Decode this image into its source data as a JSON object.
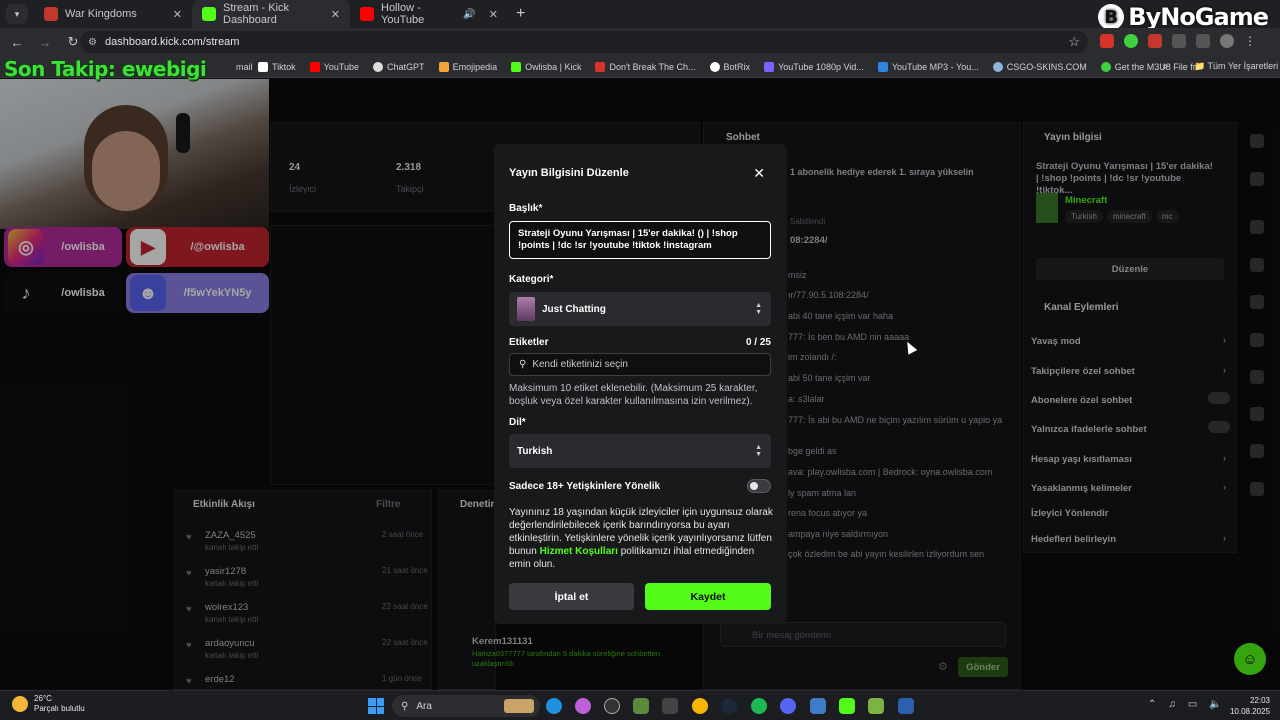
{
  "browser": {
    "tabs": [
      {
        "label": "War Kingdoms",
        "color": "#c0392b",
        "active": false
      },
      {
        "label": "Stream - Kick Dashboard",
        "color": "#53fc18",
        "active": true
      },
      {
        "label": "Hollow - YouTube",
        "color": "#ff0000",
        "active": false
      }
    ],
    "url": "dashboard.kick.com/stream",
    "brand": "ByNoGame",
    "bookmarks": [
      {
        "label": "Tiktok",
        "color": "#ffffff"
      },
      {
        "label": "YouTube",
        "color": "#ff0000"
      },
      {
        "label": "ChatGPT",
        "color": "#dddddd"
      },
      {
        "label": "Emojipedia",
        "color": "#f2a33a"
      },
      {
        "label": "Owlisba | Kick",
        "color": "#53fc18"
      },
      {
        "label": "Don't Break The Ch...",
        "color": "#d6332b"
      },
      {
        "label": "BotRix",
        "color": "#ffffff"
      },
      {
        "label": "YouTube 1080p Vid...",
        "color": "#7b61ff"
      },
      {
        "label": "YouTube MP3 - You...",
        "color": "#2e86de"
      },
      {
        "label": "CSGO-SKINS.COM",
        "color": "#8fb3d9"
      },
      {
        "label": "Get the M3U8 File fr...",
        "color": "#3fd13f"
      }
    ],
    "bookmarks_cut_label": "mail",
    "all_bookmarks": "Tüm Yer İşaretleri"
  },
  "overlay": {
    "follow_text": "Son Takip: ewebigi",
    "socials": [
      {
        "label": "/owlisba",
        "icon": "instagram-icon",
        "color": "#b52a9b"
      },
      {
        "label": "/@owlisba",
        "icon": "youtube-icon",
        "color": "#c4262e"
      },
      {
        "label": "/owlisba",
        "icon": "tiktok-icon",
        "color": "#101010"
      },
      {
        "label": "/f5wYekYN5y",
        "icon": "discord-icon",
        "color": "#8a80e6"
      }
    ]
  },
  "dashboard": {
    "stats": [
      {
        "value": "24",
        "label": "İzleyici"
      },
      {
        "value": "2.318",
        "label": "Takipçi"
      }
    ],
    "activity": {
      "title": "Etkinlik Akışı",
      "filter": "Filtre",
      "items": [
        {
          "name": "ZAZA_4525",
          "action": "kanalı takip etti",
          "time": "2 saat önce"
        },
        {
          "name": "yasir1278",
          "action": "kanalı takip etti",
          "time": "21 saat önce"
        },
        {
          "name": "wolrex123",
          "action": "kanalı takip etti",
          "time": "22 saat önce"
        },
        {
          "name": "ardaoyuncu",
          "action": "kanalı takip etti",
          "time": "22 saat önce"
        },
        {
          "name": "erde12",
          "action": "",
          "time": "1 gün önce"
        }
      ]
    },
    "moderation": {
      "title": "Denetim",
      "last_user": "Kerem131131",
      "last_detail": "Hamza0377777 tarafından 5 dakika süreliğine sohbetten uzaklaştırıldı"
    },
    "chat": {
      "title": "Sohbet",
      "gift_banner": "1 abonelik hediye ederek 1. sıraya yükselin",
      "pinned_label": "Sabitlendi",
      "pinned_text": "08:2284/",
      "lines": [
        "msiz",
        "ır/77.90.5.108:2284/",
        "abi 40 tane içşim var haha",
        "777: İs ben bu AMD nin aaaaa",
        "im zolandı /:",
        "abi 50 tane içşim var",
        "a: s3lalar",
        "777: İs abi bu AMD ne biçim yazılım sürüm u yapio ya",
        "bge geldi as",
        "ava: play.owlisba.com | Bedrock: oyna.owlisba.com",
        "ly spam atma lan",
        "rena focus atıyor ya",
        "ampaya niye saldırmıyon",
        "çok özledim be abi yayın kesilirlen izliyordum sen"
      ],
      "input_placeholder": "Bir mesaj gönderin",
      "send": "Gönder"
    },
    "stream_info": {
      "title": "Yayın bilgisi",
      "text": "Strateji Oyunu Yarışması | 15'er dakika! | !shop !points | !dc !sr !youtube !tiktok...",
      "category": "Minecraft",
      "tags": [
        "Turkish",
        "minecraft",
        "mc"
      ],
      "edit": "Düzenle"
    },
    "channel_actions": {
      "title": "Kanal Eylemleri",
      "items": [
        {
          "label": "Yavaş mod",
          "control": "chevron"
        },
        {
          "label": "Takipçilere özel sohbet",
          "control": "chevron"
        },
        {
          "label": "Abonelere özel sohbet",
          "control": "toggle"
        },
        {
          "label": "Yalnızca ifadelerle sohbet",
          "control": "toggle"
        },
        {
          "label": "Hesap yaşı kısıtlaması",
          "control": "chevron"
        },
        {
          "label": "Yasaklanmış kelimeler",
          "control": "chevron"
        },
        {
          "label": "İzleyici Yönlendir",
          "control": "none"
        },
        {
          "label": "Hedefleri belirleyin",
          "control": "chevron"
        }
      ]
    }
  },
  "modal": {
    "title": "Yayın Bilgisini Düzenle",
    "title_label": "Başlık*",
    "title_value": "Strateji Oyunu Yarışması | 15'er dakika! () | !shop !points | !dc !sr !youtube !tiktok !instagram",
    "category_label": "Kategori*",
    "category_value": "Just Chatting",
    "tags_label": "Etiketler",
    "tags_count": "0 / 25",
    "tags_placeholder": "Kendi etiketinizi seçin",
    "tags_help": "Maksimum 10 etiket eklenebilir. (Maksimum 25 karakter, boşluk veya özel karakter kullanılmasına izin verilmez).",
    "language_label": "Dil*",
    "language_value": "Turkish",
    "adult_label": "Sadece 18+ Yetişkinlere Yönelik",
    "adult_enabled": false,
    "adult_help_before": "Yayınınız 18 yaşından küçük izleyiciler için uygunsuz olarak değerlendirilebilecek içerik barındırıyorsa bu ayarı etkinleştirin. Yetişkinlere yönelik içerik yayınlıyorsanız lütfen bunun ",
    "adult_help_link": "Hizmet Koşulları",
    "adult_help_after": " politikamızı ihlal etmediğinden emin olun.",
    "cancel": "İptal et",
    "save": "Kaydet"
  },
  "taskbar": {
    "temperature": "26°C",
    "weather": "Parçalı bulutlu",
    "search": "Ara",
    "time": "22:03",
    "date": "10.08.2025"
  }
}
